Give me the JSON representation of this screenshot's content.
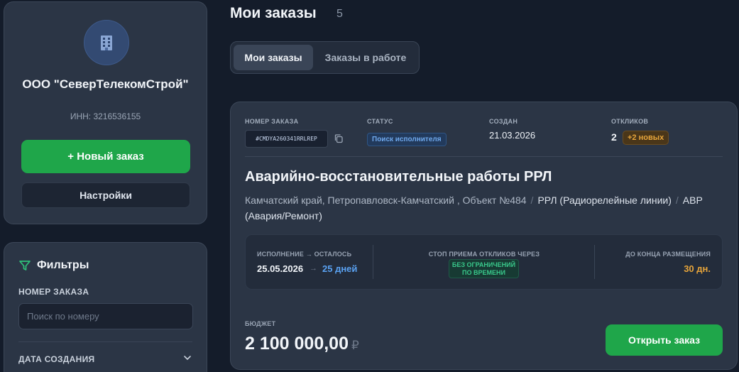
{
  "company": {
    "icon": "building-icon",
    "name": "ООО \"СеверТелекомСтрой\"",
    "inn": "ИНН: 3216536155",
    "new_order_label": "+ Новый заказ",
    "settings_label": "Настройки"
  },
  "filters": {
    "title": "Фильтры",
    "order_number_label": "НОМЕР ЗАКАЗА",
    "search_placeholder": "Поиск по номеру",
    "search_value": "",
    "created_label": "ДАТА СОЗДАНИЯ"
  },
  "header": {
    "title": "Мои заказы",
    "count": "5",
    "tabs": [
      {
        "label": "Мои заказы",
        "active": true
      },
      {
        "label": "Заказы в работе",
        "active": false
      }
    ]
  },
  "order": {
    "id_label": "НОМЕР ЗАКАЗА",
    "id": "#CMDYA260341RRLREP",
    "status_label": "СТАТУС",
    "status": "Поиск исполнителя",
    "created_label": "СОЗДАН",
    "created": "21.03.2026",
    "responses_label": "ОТКЛИКОВ",
    "responses": "2",
    "new_responses": "+2 новых",
    "title": "Аварийно-восстановительные работы РРЛ",
    "location": "Камчатский край, Петропавловск-Камчатский , Объект №484",
    "category": "РРЛ (Радиорелейные линии)",
    "subcategory": "АВР (Авария/Ремонт)",
    "separator": "/",
    "execution_label": "ИСПОЛНЕНИЕ → ОСТАЛОСЬ",
    "execution_date": "25.05.2026",
    "arrow": "→",
    "days_left": "25 дней",
    "stop_label": "СТОП ПРИЕМА ОТКЛИКОВ ЧЕРЕЗ",
    "no_limit": "БЕЗ ОГРАНИЧЕНИЙ ПО ВРЕМЕНИ",
    "placement_label": "ДО КОНЦА РАЗМЕЩЕНИЯ",
    "placement_days": "30 дн.",
    "budget_label": "БЮДЖЕТ",
    "budget": "2 100 000,00",
    "currency": "₽",
    "open_label": "Открыть заказ"
  },
  "colors": {
    "accent_green": "#1fa64a",
    "status_blue": "#6fa8ec",
    "warning_orange": "#e7a53b",
    "success_green": "#39c98b"
  }
}
